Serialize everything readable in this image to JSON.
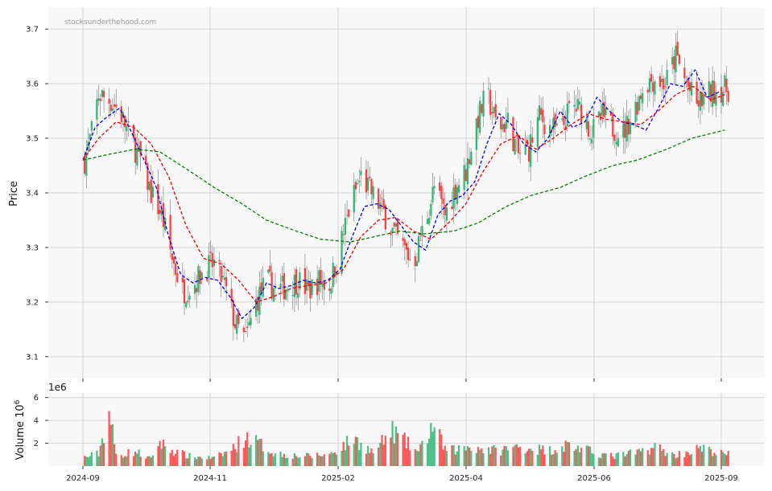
{
  "watermark": "stocksunderthehood.com",
  "colors": {
    "up": "#2cb673",
    "down": "#ff3b3b",
    "ma_short": "#0000ee",
    "ma_mid": "#ee0000",
    "ma_long": "#007f00",
    "panel_bg": "#f8f8f8",
    "grid": "#d4d4d4"
  },
  "chart_data": [
    {
      "type": "candlestick",
      "ylabel": "Price",
      "ylim": [
        3.06,
        3.74
      ],
      "yticks": [
        "3.1",
        "3.2",
        "3.3",
        "3.4",
        "3.5",
        "3.6",
        "3.7"
      ],
      "xticks": [
        "2024-09",
        "2024-11",
        "2025-02",
        "2025-04",
        "2025-06",
        "2025-09"
      ],
      "grid": true,
      "close_path": [
        [
          "2024-09-02",
          3.46
        ],
        [
          "2024-09-06",
          3.51
        ],
        [
          "2024-09-10",
          3.58
        ],
        [
          "2024-09-16",
          3.57
        ],
        [
          "2024-09-22",
          3.55
        ],
        [
          "2024-09-28",
          3.5
        ],
        [
          "2024-10-04",
          3.46
        ],
        [
          "2024-10-10",
          3.4
        ],
        [
          "2024-10-16",
          3.36
        ],
        [
          "2024-10-22",
          3.28
        ],
        [
          "2024-10-28",
          3.22
        ],
        [
          "2024-11-03",
          3.23
        ],
        [
          "2024-11-09",
          3.26
        ],
        [
          "2024-11-15",
          3.27
        ],
        [
          "2024-11-21",
          3.23
        ],
        [
          "2024-11-27",
          3.16
        ],
        [
          "2024-12-03",
          3.13
        ],
        [
          "2024-12-09",
          3.2
        ],
        [
          "2024-12-15",
          3.24
        ],
        [
          "2024-12-21",
          3.22
        ],
        [
          "2024-12-27",
          3.23
        ],
        [
          "2025-01-02",
          3.24
        ],
        [
          "2025-01-08",
          3.22
        ],
        [
          "2025-01-14",
          3.24
        ],
        [
          "2025-01-20",
          3.23
        ],
        [
          "2025-01-26",
          3.3
        ],
        [
          "2025-02-01",
          3.38
        ],
        [
          "2025-02-07",
          3.43
        ],
        [
          "2025-02-13",
          3.4
        ],
        [
          "2025-02-19",
          3.37
        ],
        [
          "2025-02-25",
          3.33
        ],
        [
          "2025-03-03",
          3.3
        ],
        [
          "2025-03-09",
          3.27
        ],
        [
          "2025-03-15",
          3.34
        ],
        [
          "2025-03-21",
          3.41
        ],
        [
          "2025-03-27",
          3.36
        ],
        [
          "2025-04-02",
          3.41
        ],
        [
          "2025-04-08",
          3.44
        ],
        [
          "2025-04-14",
          3.53
        ],
        [
          "2025-04-20",
          3.58
        ],
        [
          "2025-04-26",
          3.52
        ],
        [
          "2025-05-02",
          3.53
        ],
        [
          "2025-05-08",
          3.47
        ],
        [
          "2025-05-14",
          3.48
        ],
        [
          "2025-05-20",
          3.54
        ],
        [
          "2025-05-26",
          3.52
        ],
        [
          "2025-06-01",
          3.51
        ],
        [
          "2025-06-07",
          3.56
        ],
        [
          "2025-06-13",
          3.55
        ],
        [
          "2025-06-19",
          3.51
        ],
        [
          "2025-06-25",
          3.54
        ],
        [
          "2025-07-01",
          3.52
        ],
        [
          "2025-07-07",
          3.51
        ],
        [
          "2025-07-13",
          3.55
        ],
        [
          "2025-07-19",
          3.6
        ],
        [
          "2025-07-25",
          3.61
        ],
        [
          "2025-07-31",
          3.6
        ],
        [
          "2025-08-06",
          3.65
        ],
        [
          "2025-08-12",
          3.6
        ],
        [
          "2025-08-18",
          3.56
        ],
        [
          "2025-08-24",
          3.58
        ],
        [
          "2025-08-30",
          3.59
        ]
      ],
      "series": [
        {
          "values": [
            [
              "2024-09-01",
              3.46
            ],
            [
              "2024-09-08",
              3.52
            ],
            [
              "2024-09-15",
              3.54
            ],
            [
              "2024-09-22",
              3.555
            ],
            [
              "2024-09-29",
              3.51
            ],
            [
              "2024-10-06",
              3.46
            ],
            [
              "2024-10-13",
              3.41
            ],
            [
              "2024-10-20",
              3.32
            ],
            [
              "2024-10-27",
              3.25
            ],
            [
              "2024-11-03",
              3.235
            ],
            [
              "2024-11-10",
              3.245
            ],
            [
              "2024-11-17",
              3.24
            ],
            [
              "2024-11-24",
              3.21
            ],
            [
              "2024-12-01",
              3.17
            ],
            [
              "2024-12-08",
              3.19
            ],
            [
              "2024-12-15",
              3.235
            ],
            [
              "2024-12-22",
              3.225
            ],
            [
              "2024-12-29",
              3.23
            ],
            [
              "2025-01-05",
              3.24
            ],
            [
              "2025-01-12",
              3.235
            ],
            [
              "2025-01-19",
              3.24
            ],
            [
              "2025-01-26",
              3.26
            ],
            [
              "2025-02-02",
              3.32
            ],
            [
              "2025-02-09",
              3.375
            ],
            [
              "2025-02-16",
              3.38
            ],
            [
              "2025-02-23",
              3.37
            ],
            [
              "2025-03-02",
              3.34
            ],
            [
              "2025-03-09",
              3.31
            ],
            [
              "2025-03-16",
              3.295
            ],
            [
              "2025-03-23",
              3.36
            ],
            [
              "2025-03-30",
              3.385
            ],
            [
              "2025-04-06",
              3.395
            ],
            [
              "2025-04-13",
              3.42
            ],
            [
              "2025-04-20",
              3.49
            ],
            [
              "2025-04-27",
              3.545
            ],
            [
              "2025-05-04",
              3.525
            ],
            [
              "2025-05-11",
              3.49
            ],
            [
              "2025-05-18",
              3.475
            ],
            [
              "2025-05-25",
              3.5
            ],
            [
              "2025-06-01",
              3.55
            ],
            [
              "2025-06-08",
              3.52
            ],
            [
              "2025-06-15",
              3.53
            ],
            [
              "2025-06-22",
              3.575
            ],
            [
              "2025-06-29",
              3.55
            ],
            [
              "2025-07-06",
              3.53
            ],
            [
              "2025-07-13",
              3.525
            ],
            [
              "2025-07-20",
              3.515
            ],
            [
              "2025-07-27",
              3.555
            ],
            [
              "2025-08-03",
              3.6
            ],
            [
              "2025-08-10",
              3.595
            ],
            [
              "2025-08-17",
              3.625
            ],
            [
              "2025-08-24",
              3.575
            ],
            [
              "2025-08-31",
              3.585
            ]
          ]
        },
        {
          "values": [
            [
              "2024-09-01",
              3.46
            ],
            [
              "2024-09-10",
              3.5
            ],
            [
              "2024-09-20",
              3.53
            ],
            [
              "2024-09-30",
              3.52
            ],
            [
              "2024-10-10",
              3.49
            ],
            [
              "2024-10-20",
              3.43
            ],
            [
              "2024-10-30",
              3.34
            ],
            [
              "2024-11-09",
              3.28
            ],
            [
              "2024-11-19",
              3.27
            ],
            [
              "2024-11-29",
              3.24
            ],
            [
              "2024-12-09",
              3.2
            ],
            [
              "2024-12-19",
              3.21
            ],
            [
              "2024-12-29",
              3.225
            ],
            [
              "2025-01-08",
              3.23
            ],
            [
              "2025-01-18",
              3.235
            ],
            [
              "2025-01-28",
              3.26
            ],
            [
              "2025-02-07",
              3.32
            ],
            [
              "2025-02-17",
              3.35
            ],
            [
              "2025-02-27",
              3.355
            ],
            [
              "2025-03-09",
              3.33
            ],
            [
              "2025-03-19",
              3.315
            ],
            [
              "2025-03-29",
              3.345
            ],
            [
              "2025-04-08",
              3.38
            ],
            [
              "2025-04-18",
              3.44
            ],
            [
              "2025-04-28",
              3.49
            ],
            [
              "2025-05-08",
              3.505
            ],
            [
              "2025-05-18",
              3.48
            ],
            [
              "2025-05-28",
              3.5
            ],
            [
              "2025-06-07",
              3.525
            ],
            [
              "2025-06-17",
              3.545
            ],
            [
              "2025-06-27",
              3.535
            ],
            [
              "2025-07-07",
              3.53
            ],
            [
              "2025-07-17",
              3.525
            ],
            [
              "2025-07-27",
              3.55
            ],
            [
              "2025-08-06",
              3.58
            ],
            [
              "2025-08-16",
              3.595
            ],
            [
              "2025-08-26",
              3.57
            ],
            [
              "2025-09-03",
              3.58
            ]
          ]
        },
        {
          "values": [
            [
              "2024-09-01",
              3.46
            ],
            [
              "2024-09-15",
              3.47
            ],
            [
              "2024-10-01",
              3.48
            ],
            [
              "2024-10-15",
              3.475
            ],
            [
              "2024-11-01",
              3.44
            ],
            [
              "2024-11-15",
              3.41
            ],
            [
              "2024-12-01",
              3.38
            ],
            [
              "2024-12-15",
              3.35
            ],
            [
              "2025-01-01",
              3.33
            ],
            [
              "2025-01-15",
              3.315
            ],
            [
              "2025-02-01",
              3.31
            ],
            [
              "2025-02-15",
              3.32
            ],
            [
              "2025-03-01",
              3.33
            ],
            [
              "2025-03-15",
              3.325
            ],
            [
              "2025-04-01",
              3.33
            ],
            [
              "2025-04-15",
              3.345
            ],
            [
              "2025-05-01",
              3.375
            ],
            [
              "2025-05-15",
              3.395
            ],
            [
              "2025-06-01",
              3.41
            ],
            [
              "2025-06-15",
              3.43
            ],
            [
              "2025-07-01",
              3.45
            ],
            [
              "2025-07-15",
              3.46
            ],
            [
              "2025-08-01",
              3.48
            ],
            [
              "2025-08-15",
              3.5
            ],
            [
              "2025-09-03",
              3.515
            ]
          ]
        }
      ]
    },
    {
      "type": "bar",
      "ylabel": "Volume  10^6",
      "offset_text": "1e6",
      "ylim": [
        0,
        6.4
      ],
      "yticks": [
        "2",
        "4",
        "6"
      ],
      "xticks": [
        "2024-09",
        "2024-11",
        "2025-02",
        "2025-04",
        "2025-06",
        "2025-09"
      ],
      "volume_levels": [
        [
          "2024-09-02",
          0.9
        ],
        [
          "2024-09-10",
          1.3
        ],
        [
          "2024-09-16",
          5.6
        ],
        [
          "2024-09-20",
          1.1
        ],
        [
          "2024-10-01",
          1.5
        ],
        [
          "2024-10-10",
          0.7
        ],
        [
          "2024-10-14",
          2.5
        ],
        [
          "2024-10-22",
          1.6
        ],
        [
          "2024-11-01",
          1.0
        ],
        [
          "2024-11-15",
          0.8
        ],
        [
          "2024-11-25",
          1.7
        ],
        [
          "2024-12-03",
          3.0
        ],
        [
          "2024-12-10",
          2.4
        ],
        [
          "2024-12-20",
          1.3
        ],
        [
          "2025-01-05",
          1.0
        ],
        [
          "2025-01-20",
          1.2
        ],
        [
          "2025-02-03",
          2.8
        ],
        [
          "2025-02-14",
          1.4
        ],
        [
          "2025-02-25",
          3.6
        ],
        [
          "2025-03-05",
          2.4
        ],
        [
          "2025-03-12",
          1.4
        ],
        [
          "2025-03-20",
          4.2
        ],
        [
          "2025-03-28",
          1.5
        ],
        [
          "2025-04-10",
          2.0
        ],
        [
          "2025-04-25",
          1.6
        ],
        [
          "2025-05-10",
          2.0
        ],
        [
          "2025-05-25",
          1.6
        ],
        [
          "2025-06-05",
          2.2
        ],
        [
          "2025-06-20",
          1.4
        ],
        [
          "2025-07-01",
          1.0
        ],
        [
          "2025-07-15",
          1.4
        ],
        [
          "2025-07-25",
          2.0
        ],
        [
          "2025-08-05",
          1.1
        ],
        [
          "2025-08-20",
          1.8
        ],
        [
          "2025-09-03",
          1.2
        ]
      ]
    }
  ]
}
